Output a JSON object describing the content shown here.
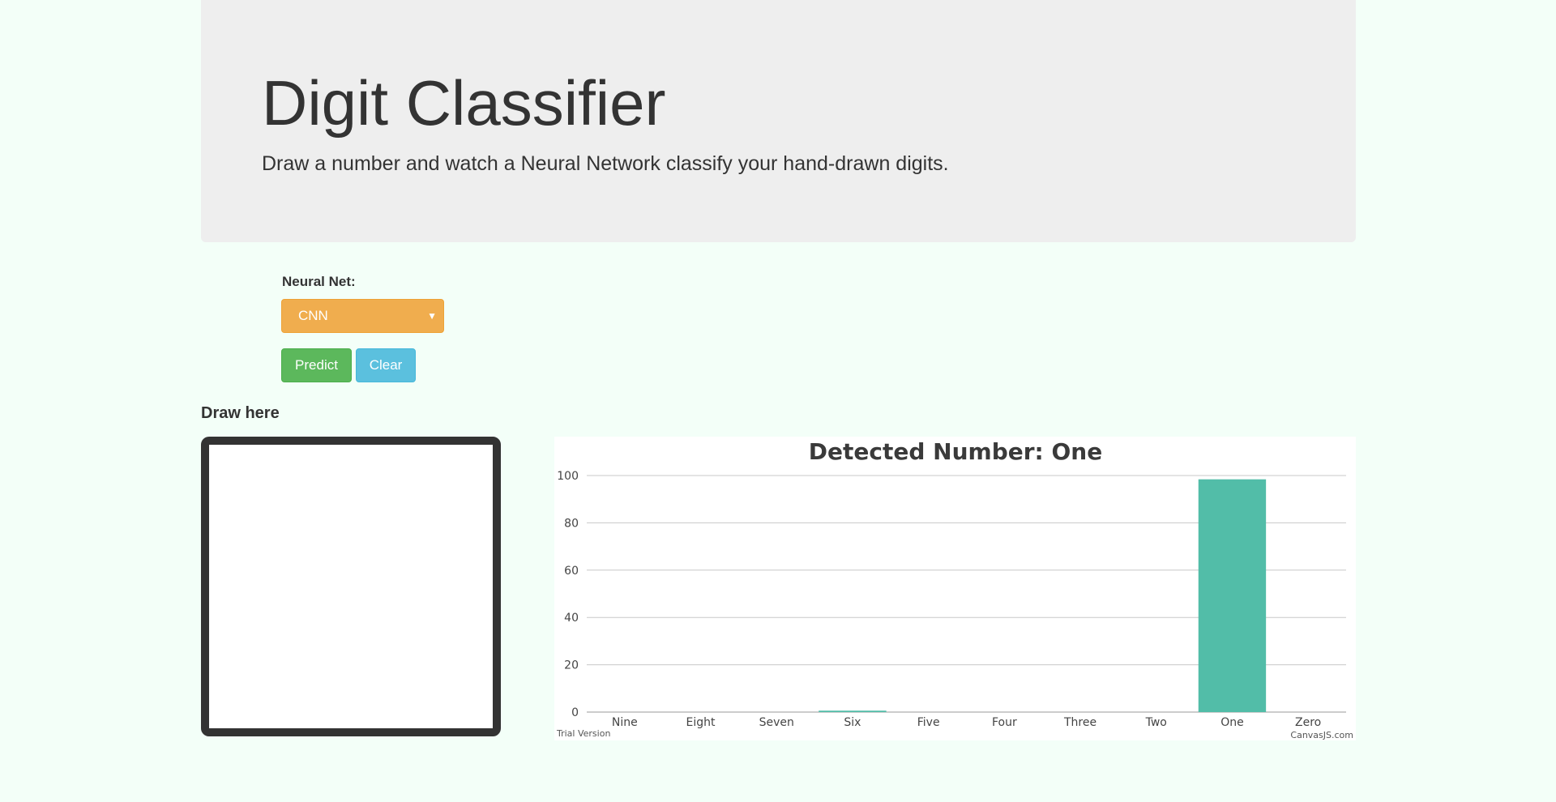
{
  "header": {
    "title": "Digit Classifier",
    "subtitle": "Draw a number and watch a Neural Network classify your hand-drawn digits."
  },
  "controls": {
    "net_label": "Neural Net:",
    "net_selected": "CNN",
    "predict_label": "Predict",
    "clear_label": "Clear",
    "colors": {
      "select_bg": "#f0ad4e",
      "predict_bg": "#5cb85c",
      "clear_bg": "#5bc0de"
    }
  },
  "canvas": {
    "label": "Draw here"
  },
  "chart_data": {
    "type": "bar",
    "title": "Detected Number: One",
    "categories": [
      "Nine",
      "Eight",
      "Seven",
      "Six",
      "Five",
      "Four",
      "Three",
      "Two",
      "One",
      "Zero"
    ],
    "values": [
      0,
      0,
      0,
      0.6,
      0,
      0,
      0,
      0,
      98.4,
      0
    ],
    "ylim": [
      0,
      100
    ],
    "yticks": [
      0,
      20,
      40,
      60,
      80,
      100
    ],
    "bar_color": "#52bda8",
    "grid": true,
    "trial_text": "Trial Version",
    "credit_text": "CanvasJS.com"
  }
}
